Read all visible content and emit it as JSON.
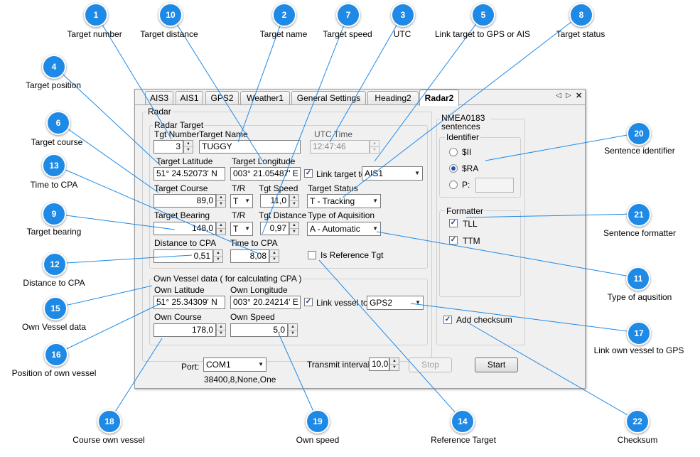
{
  "tabs": [
    "AIS3",
    "AIS1",
    "GPS2",
    "Weather1",
    "General Settings",
    "Heading2",
    "Radar2"
  ],
  "tab_nav": {
    "prev": "◁",
    "next": "▷",
    "close": "✕"
  },
  "radar": {
    "group_title": "Radar",
    "target_group_title": "Radar Target",
    "tgt_number_label": "Tgt Number",
    "tgt_number_value": "3",
    "target_name_label": "Target Name",
    "target_name_value": "TUGGY",
    "utc_label": "UTC Time",
    "utc_value": "12:47:46",
    "target_latitude_label": "Target Latitude",
    "target_latitude_value": "51° 24.52073' N",
    "target_longitude_label": "Target Longitude",
    "target_longitude_value": "003° 21.05487' E",
    "link_target_label": "Link target to",
    "link_target_value": "AIS1",
    "target_course_label": "Target Course",
    "target_course_value": "89,0",
    "tr_label_1": "T/R",
    "tr_value_1": "T",
    "tgt_speed_label": "Tgt Speed",
    "tgt_speed_value": "11,0",
    "target_status_label": "Target Status",
    "target_status_value": "T - Tracking",
    "target_bearing_label": "Target Bearing",
    "target_bearing_value": "148,0",
    "tr_label_2": "T/R",
    "tr_value_2": "T",
    "tgt_distance_label": "Tgt Distance",
    "tgt_distance_value": "0,97",
    "type_aquisition_label": "Type of Aquisition",
    "type_aquisition_value": "A - Automatic",
    "distance_cpa_label": "Distance to CPA",
    "distance_cpa_value": "0,51",
    "time_cpa_label": "Time to CPA",
    "time_cpa_value": "8,08",
    "is_reference_label": "Is Reference Tgt"
  },
  "own_vessel": {
    "group_title": "Own Vessel data ( for calculating CPA )",
    "latitude_label": "Own Latitude",
    "latitude_value": "51° 25.34309' N",
    "longitude_label": "Own Longitude",
    "longitude_value": "003° 20.24214' E",
    "link_vessel_label": "Link vessel  to",
    "link_vessel_value": "GPS2",
    "course_label": "Own Course",
    "course_value": "178,0",
    "speed_label": "Own Speed",
    "speed_value": "5,0"
  },
  "nmea": {
    "group_title": "NMEA0183 sentences",
    "identifier_title": "Identifier",
    "opt_ii": "$II",
    "opt_ra": "$RA",
    "opt_p": "P:",
    "formatter_title": "Formatter",
    "tll": "TLL",
    "ttm": "TTM",
    "add_checksum": "Add checksum"
  },
  "bottom": {
    "port_label": "Port:",
    "port_value": "COM1",
    "port_settings": "38400,8,None,One",
    "transmit_label": "Transmit interval:",
    "transmit_value": "10,0",
    "stop": "Stop",
    "start": "Start"
  },
  "callouts": [
    {
      "num": "1",
      "label": "Target number"
    },
    {
      "num": "10",
      "label": "Target distance"
    },
    {
      "num": "2",
      "label": "Target name"
    },
    {
      "num": "7",
      "label": "Target speed"
    },
    {
      "num": "3",
      "label": "UTC"
    },
    {
      "num": "5",
      "label": "Link target to GPS or AIS"
    },
    {
      "num": "8",
      "label": "Target status"
    },
    {
      "num": "4",
      "label": "Target position"
    },
    {
      "num": "6",
      "label": "Target course"
    },
    {
      "num": "13",
      "label": "Time to CPA"
    },
    {
      "num": "9",
      "label": "Target bearing"
    },
    {
      "num": "12",
      "label": "Distance to CPA"
    },
    {
      "num": "15",
      "label": "Own Vessel data"
    },
    {
      "num": "16",
      "label": "Position of own vessel"
    },
    {
      "num": "18",
      "label": "Course own vessel"
    },
    {
      "num": "19",
      "label": "Own speed"
    },
    {
      "num": "14",
      "label": "Reference Target"
    },
    {
      "num": "22",
      "label": "Checksum"
    },
    {
      "num": "20",
      "label": "Sentence identifier"
    },
    {
      "num": "21",
      "label": "Sentence formatter"
    },
    {
      "num": "11",
      "label": "Type of aqusition"
    },
    {
      "num": "17",
      "label": "Link own vessel to GPS"
    }
  ],
  "colors": {
    "badge": "#1e8ae6",
    "leader_line": "#1e8ae6"
  }
}
